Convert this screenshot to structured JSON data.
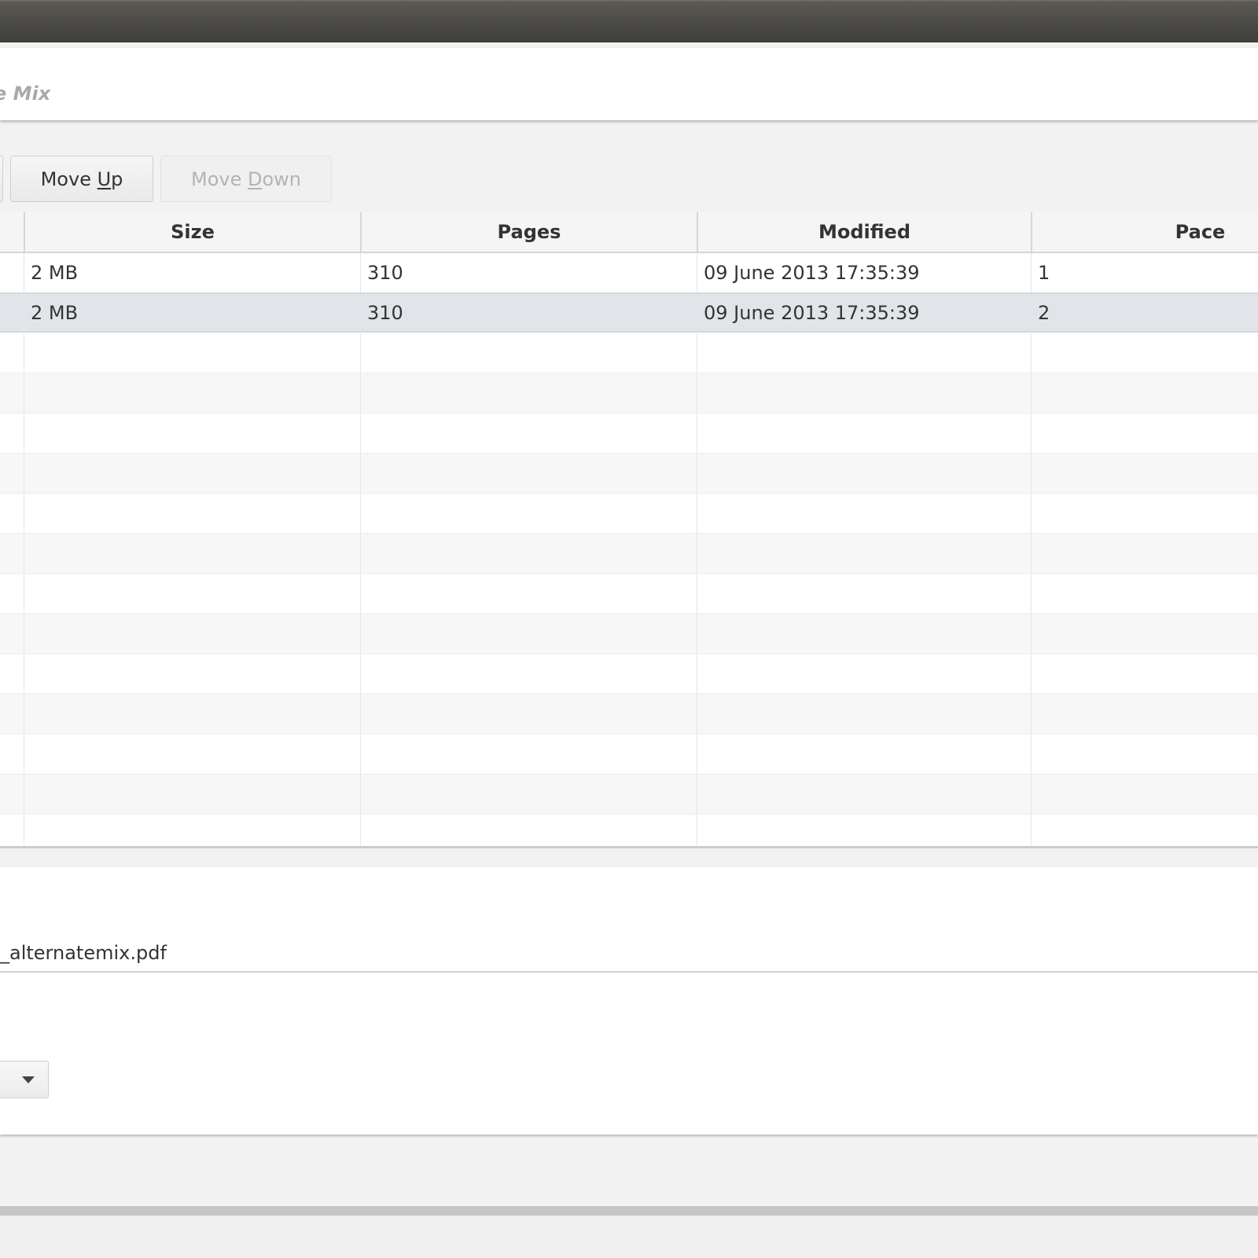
{
  "window": {
    "title": "Alternate Mix",
    "title_visible": "e Mix"
  },
  "toolbar": {
    "move_up_label": "Move Up",
    "move_up_mnemonic": "U",
    "move_down_label": "Move Down",
    "move_down_mnemonic": "D"
  },
  "table": {
    "columns": [
      "Size",
      "Pages",
      "Modified",
      "Pace"
    ],
    "rows": [
      {
        "size": "2 MB",
        "pages": "310",
        "modified": "09 June 2013 17:35:39",
        "pace": "1"
      },
      {
        "size": "2 MB",
        "pages": "310",
        "modified": "09 June 2013 17:35:39",
        "pace": "2"
      }
    ],
    "selected_row": 1
  },
  "destination": {
    "value": "_alternatemix.pdf"
  },
  "colors": {
    "selection": "#e1e5ea",
    "titlebar": "#4a4945"
  }
}
